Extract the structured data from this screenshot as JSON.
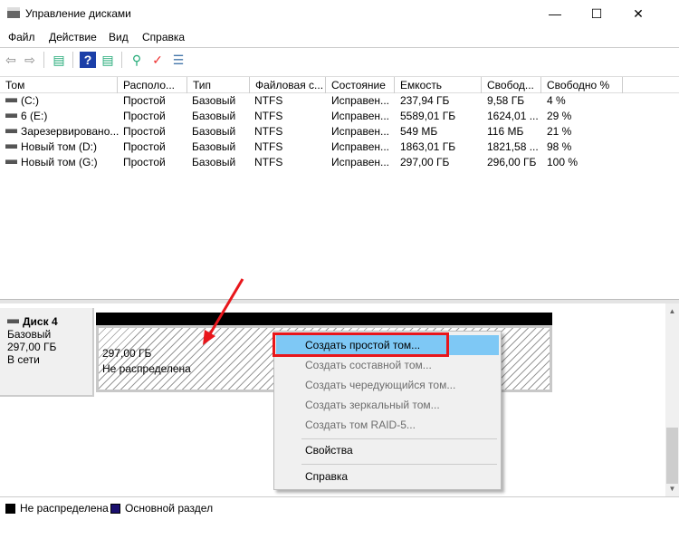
{
  "window": {
    "title": "Управление дисками",
    "minimize": "—",
    "maximize": "☐",
    "close": "✕"
  },
  "menu": [
    "Файл",
    "Действие",
    "Вид",
    "Справка"
  ],
  "toolbar": [
    "back-icon",
    "forward-icon",
    "console-tree-icon",
    "help-icon",
    "action-pane-icon",
    "connect-icon",
    "check-icon",
    "properties-icon"
  ],
  "table": {
    "headers": [
      "Том",
      "Располо...",
      "Тип",
      "Файловая с...",
      "Состояние",
      "Емкость",
      "Свобод...",
      "Свободно %"
    ],
    "rows": [
      [
        "(C:)",
        "Простой",
        "Базовый",
        "NTFS",
        "Исправен...",
        "237,94 ГБ",
        "9,58 ГБ",
        "4 %"
      ],
      [
        "6 (E:)",
        "Простой",
        "Базовый",
        "NTFS",
        "Исправен...",
        "5589,01 ГБ",
        "1624,01 ...",
        "29 %"
      ],
      [
        "Зарезервировано...",
        "Простой",
        "Базовый",
        "NTFS",
        "Исправен...",
        "549 МБ",
        "116 МБ",
        "21 %"
      ],
      [
        "Новый том (D:)",
        "Простой",
        "Базовый",
        "NTFS",
        "Исправен...",
        "1863,01 ГБ",
        "1821,58 ...",
        "98 %"
      ],
      [
        "Новый том (G:)",
        "Простой",
        "Базовый",
        "NTFS",
        "Исправен...",
        "297,00 ГБ",
        "296,00 ГБ",
        "100 %"
      ]
    ]
  },
  "disk": {
    "name": "Диск 4",
    "type": "Базовый",
    "size": "297,00 ГБ",
    "status": "В сети"
  },
  "partition": {
    "size": "297,00 ГБ",
    "state": "Не распределена"
  },
  "context_menu": {
    "items": [
      {
        "label": "Создать простой том...",
        "enabled": true,
        "highlighted": true
      },
      {
        "label": "Создать составной том...",
        "enabled": false
      },
      {
        "label": "Создать чередующийся том...",
        "enabled": false
      },
      {
        "label": "Создать зеркальный том...",
        "enabled": false
      },
      {
        "label": "Создать том RAID-5...",
        "enabled": false
      },
      {
        "label": "Свойства",
        "enabled": true
      },
      {
        "label": "Справка",
        "enabled": true
      }
    ]
  },
  "legend": [
    {
      "label": "Не распределена",
      "color": "#000000"
    },
    {
      "label": "Основной раздел",
      "color": "#1a0f6e"
    }
  ],
  "colors": {
    "highlight": "#7ec8f5",
    "annotation": "#e8161b"
  }
}
